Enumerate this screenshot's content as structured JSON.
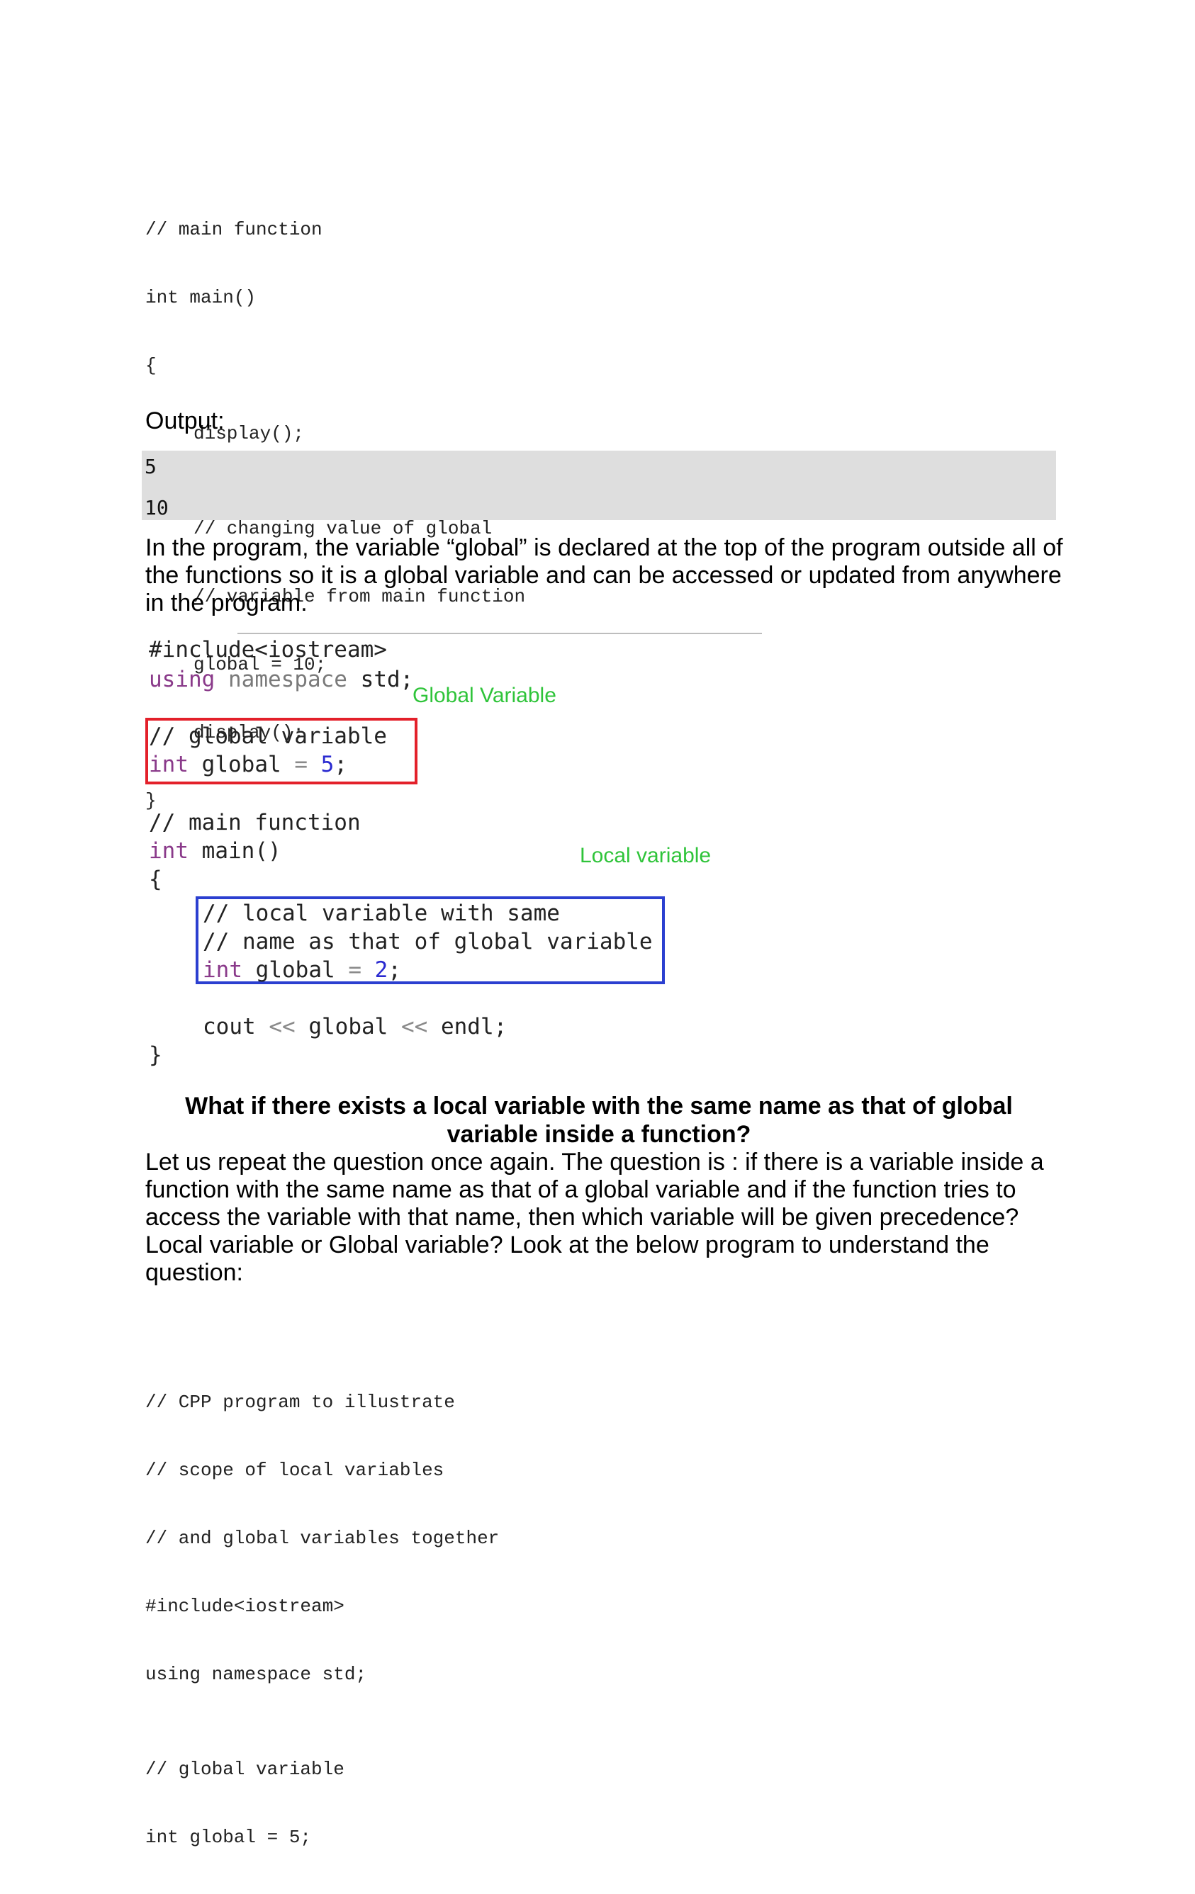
{
  "code_top": {
    "lines": [
      "// main function",
      "int main()",
      "{",
      "display();",
      "// changing value of global",
      "// variable from main function",
      "global = 10;",
      "display();",
      "}"
    ]
  },
  "output": {
    "label": "Output:",
    "values": [
      "5",
      "10"
    ]
  },
  "explain_para": "In the program, the variable “global” is declared at the top of the program outside all of the functions so it is a global variable and can be accessed or updated from anywhere in the program.",
  "figure": {
    "l1": "#include<iostream>",
    "l2_kw": "using",
    "l2_ns": "namespace",
    "l2_rest": "std;",
    "global_label": "Global Variable",
    "g_comment": "// global variable",
    "g_kw": "int",
    "g_name": "global",
    "g_eq": "=",
    "g_val": "5",
    "g_semi": ";",
    "m_comment": "// main function",
    "m_kw": "int",
    "m_name": "main()",
    "local_label": "Local variable",
    "open_brace": "{",
    "l_comment1": "// local variable with same",
    "l_comment2": "// name as that of global variable",
    "l_kw": "int",
    "l_name": "global",
    "l_eq": "=",
    "l_val": "2",
    "l_semi": ";",
    "cout_a": "cout",
    "cout_op1": "<<",
    "cout_b": "global",
    "cout_op2": "<<",
    "cout_c": "endl;",
    "close_brace": "}"
  },
  "heading": "What if there exists a local variable with the same name as that of global variable inside a function?",
  "question_para": "Let us repeat the question once again. The question is : if there is a variable inside a function with the same name as that of a global variable and if the function tries to access the variable with that name, then which variable will be given precedence? Local variable or Global variable? Look at the below program to understand the question:",
  "code_bottom": {
    "lines": [
      "// CPP program to illustrate",
      "// scope of local variables",
      "// and global variables together",
      "#include<iostream>",
      "using namespace std;",
      "// global variable",
      "int global = 5;"
    ]
  }
}
